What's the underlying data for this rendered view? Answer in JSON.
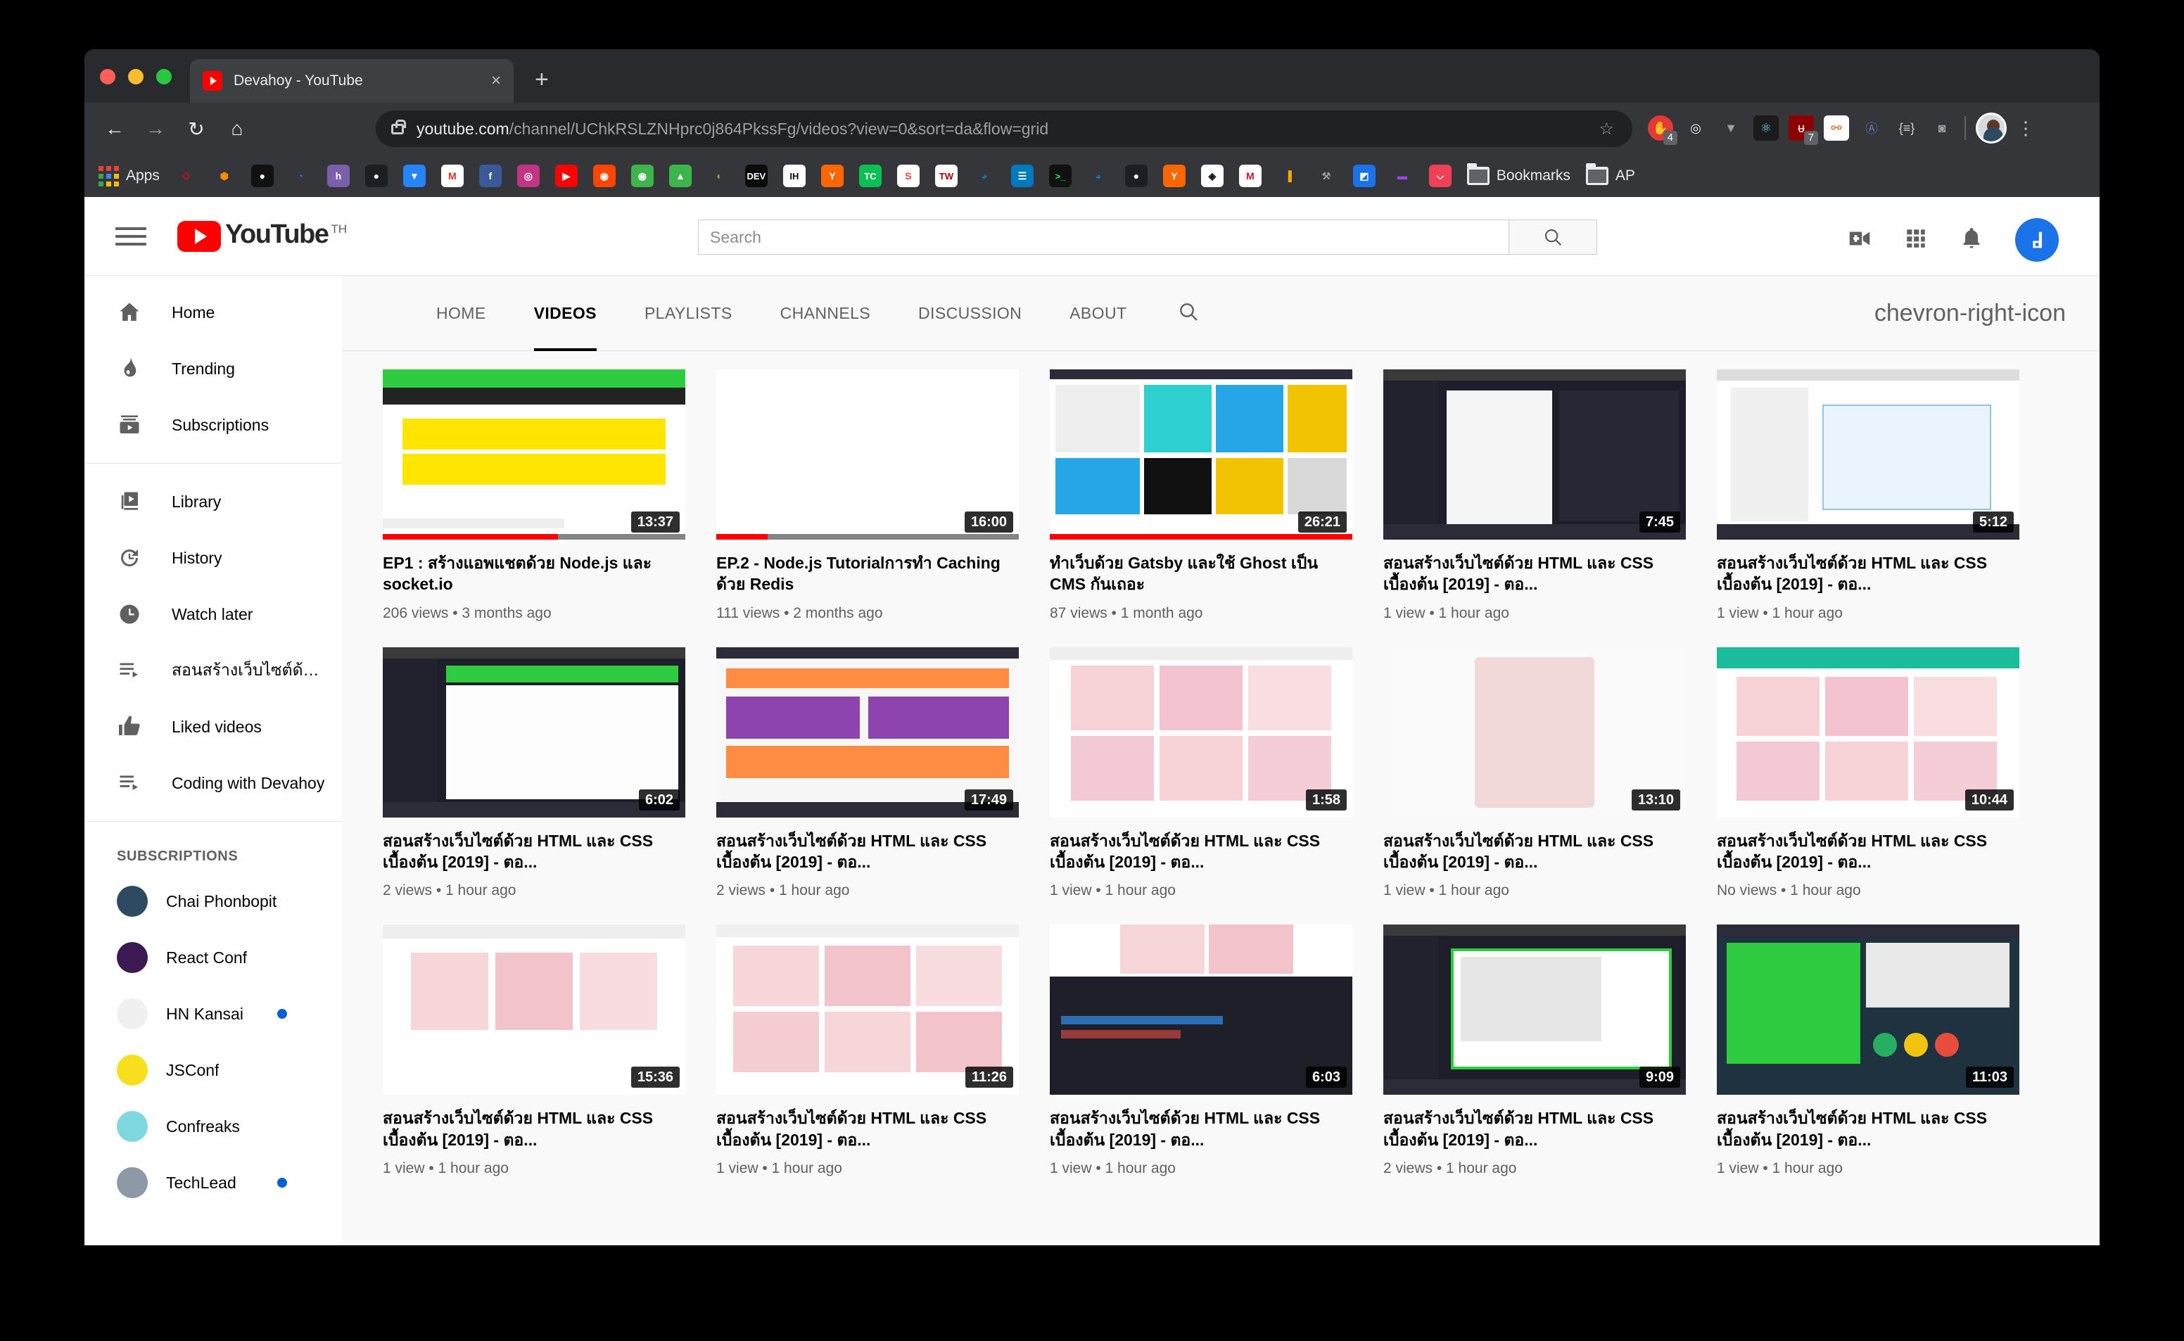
{
  "browser": {
    "tab_title": "Devahoy - YouTube",
    "tab_close": "×",
    "new_tab": "+",
    "nav": {
      "back": "←",
      "forward": "→",
      "reload": "↻",
      "home": "⌂"
    },
    "url_host": "youtube.com",
    "url_path": "/channel/UChkRSLZNHprc0j864PkssFg/videos?view=0&sort=da&flow=grid",
    "star": "☆",
    "kebab": "⋮",
    "extension_badges": {
      "adblock_count": "4",
      "ublock_count": "7"
    },
    "bookmarks": [
      {
        "name": "apps",
        "label": "Apps",
        "icon": "apps-grid-icon",
        "color": "#4285f4"
      },
      {
        "name": "opera",
        "label": "",
        "icon": "opera-icon",
        "glyph": "O",
        "color": "#cc0f16",
        "bg": "transparent"
      },
      {
        "name": "cube",
        "label": "",
        "icon": "orange-cube-icon",
        "glyph": "⬢",
        "color": "#ff8a00",
        "bg": "transparent"
      },
      {
        "name": "panda",
        "label": "",
        "icon": "panda-icon",
        "glyph": "●",
        "color": "#ffffff",
        "bg": "#111111"
      },
      {
        "name": "digitalocean",
        "label": "",
        "icon": "droplet-icon",
        "glyph": "◔",
        "color": "#0080ff",
        "bg": "transparent"
      },
      {
        "name": "heroku",
        "label": "",
        "icon": "heroku-icon",
        "glyph": "h",
        "color": "#ffffff",
        "bg": "#7b5fab"
      },
      {
        "name": "github-1",
        "label": "",
        "icon": "github-icon",
        "glyph": "●",
        "color": "#ffffff",
        "bg": "#1b1f23"
      },
      {
        "name": "bitbucket",
        "label": "",
        "icon": "bitbucket-icon",
        "glyph": "▼",
        "color": "#ffffff",
        "bg": "#2684ff"
      },
      {
        "name": "gmail",
        "label": "",
        "icon": "gmail-icon",
        "glyph": "M",
        "color": "#d93025",
        "bg": "#ffffff"
      },
      {
        "name": "facebook",
        "label": "",
        "icon": "facebook-icon",
        "glyph": "f",
        "color": "#ffffff",
        "bg": "#3b5998"
      },
      {
        "name": "instagram",
        "label": "",
        "icon": "instagram-icon",
        "glyph": "◎",
        "color": "#ffffff",
        "bg": "#c13584"
      },
      {
        "name": "youtube",
        "label": "",
        "icon": "youtube-icon",
        "glyph": "▶",
        "color": "#ffffff",
        "bg": "#ff0000"
      },
      {
        "name": "reddit",
        "label": "",
        "icon": "reddit-icon",
        "glyph": "◉",
        "color": "#ffffff",
        "bg": "#ff4500"
      },
      {
        "name": "ghost",
        "label": "",
        "icon": "ghost-icon",
        "glyph": "◉",
        "color": "#ffffff",
        "bg": "#3eb54b"
      },
      {
        "name": "gitlab",
        "label": "",
        "icon": "fox-icon",
        "glyph": "▲",
        "color": "#ffffff",
        "bg": "#3cb54a"
      },
      {
        "name": "envato",
        "label": "",
        "icon": "leaf-icon",
        "glyph": "◖",
        "color": "#82b541",
        "bg": "transparent"
      },
      {
        "name": "devto",
        "label": "",
        "icon": "devto-icon",
        "glyph": "DEV",
        "color": "#ffffff",
        "bg": "#0a0a0a"
      },
      {
        "name": "indiehackers",
        "label": "",
        "icon": "indiehackers-icon",
        "glyph": "IH",
        "color": "#0a0a0a",
        "bg": "#ffffff"
      },
      {
        "name": "ycombinator",
        "label": "",
        "icon": "ycombinator-icon",
        "glyph": "Y",
        "color": "#ffffff",
        "bg": "#ff6600"
      },
      {
        "name": "techcrunch",
        "label": "",
        "icon": "techcrunch-icon",
        "glyph": "TC",
        "color": "#ffffff",
        "bg": "#0abf53"
      },
      {
        "name": "sitepoint",
        "label": "",
        "icon": "s-icon",
        "glyph": "S",
        "color": "#e8453c",
        "bg": "#ffffff"
      },
      {
        "name": "tw",
        "label": "",
        "icon": "tw-icon",
        "glyph": "TW",
        "color": "#a30000",
        "bg": "#ffffff"
      },
      {
        "name": "droplet-2",
        "label": "",
        "icon": "droplet-icon",
        "glyph": "◕",
        "color": "#0a7bbf",
        "bg": "transparent"
      },
      {
        "name": "trello",
        "label": "",
        "icon": "trello-icon",
        "glyph": "☰",
        "color": "#ffffff",
        "bg": "#0079bf"
      },
      {
        "name": "hashicorp",
        "label": "",
        "icon": "terminal-icon",
        "glyph": ">_",
        "color": "#00ff41",
        "bg": "#111111"
      },
      {
        "name": "droplet-3",
        "label": "",
        "icon": "droplet-icon",
        "glyph": "◕",
        "color": "#0a7bbf",
        "bg": "transparent"
      },
      {
        "name": "github-2",
        "label": "",
        "icon": "github-icon",
        "glyph": "●",
        "color": "#ffffff",
        "bg": "#1b1f23"
      },
      {
        "name": "ycombinator-2",
        "label": "",
        "icon": "ycombinator-icon",
        "glyph": "Y",
        "color": "#ffffff",
        "bg": "#ff6600"
      },
      {
        "name": "gem",
        "label": "",
        "icon": "diamond-icon",
        "glyph": "◈",
        "color": "#111111",
        "bg": "#ffffff"
      },
      {
        "name": "medium-m",
        "label": "",
        "icon": "medium-icon",
        "glyph": "M",
        "color": "#c41230",
        "bg": "#ffffff"
      },
      {
        "name": "analytics",
        "label": "",
        "icon": "bar-chart-icon",
        "glyph": "▐",
        "color": "#f9ab00",
        "bg": "transparent"
      },
      {
        "name": "toolbox",
        "label": "",
        "icon": "toolbox-icon",
        "glyph": "⚒",
        "color": "#9aa0a6",
        "bg": "transparent"
      },
      {
        "name": "blue-app",
        "label": "",
        "icon": "blue-square-icon",
        "glyph": "◩",
        "color": "#ffffff",
        "bg": "#1a73e8"
      },
      {
        "name": "purple-tag",
        "label": "",
        "icon": "tag-icon",
        "glyph": "▬",
        "color": "#a142f4",
        "bg": "transparent"
      },
      {
        "name": "pocket",
        "label": "",
        "icon": "pocket-icon",
        "glyph": "⌵",
        "color": "#ffffff",
        "bg": "#ef4056"
      },
      {
        "name": "bookmarks-folder",
        "label": "Bookmarks",
        "icon": "folder-icon"
      },
      {
        "name": "ap-folder",
        "label": "AP",
        "icon": "folder-icon"
      }
    ]
  },
  "youtube": {
    "logo_word": "YouTube",
    "country_code": "TH",
    "search": {
      "placeholder": "Search",
      "value": "",
      "button_icon": "search-icon"
    },
    "header_actions": [
      {
        "name": "create-video-button",
        "icon": "video-plus-icon"
      },
      {
        "name": "apps-button",
        "icon": "apps-grid-icon"
      },
      {
        "name": "notifications-button",
        "icon": "bell-icon"
      },
      {
        "name": "account-avatar",
        "icon": "avatar-icon",
        "color": "#1a73e8",
        "glyph": "d"
      }
    ],
    "sidebar": {
      "primary": [
        {
          "label": "Home",
          "icon": "home-icon"
        },
        {
          "label": "Trending",
          "icon": "flame-icon"
        },
        {
          "label": "Subscriptions",
          "icon": "subscriptions-icon"
        }
      ],
      "library": [
        {
          "label": "Library",
          "icon": "library-icon"
        },
        {
          "label": "History",
          "icon": "history-icon"
        },
        {
          "label": "Watch later",
          "icon": "clock-icon"
        },
        {
          "label": "สอนสร้างเว็บไซต์ด้วย ...",
          "icon": "playlist-icon"
        },
        {
          "label": "Liked videos",
          "icon": "thumbs-up-icon"
        },
        {
          "label": "Coding with Devahoy",
          "icon": "playlist-icon"
        }
      ],
      "subscriptions_heading": "SUBSCRIPTIONS",
      "subscriptions": [
        {
          "label": "Chai Phonbopit",
          "avatar": "person-avatar",
          "color": "#2e4a63",
          "unread": false
        },
        {
          "label": "React Conf",
          "avatar": "react-conf-avatar",
          "color": "#3b1a52",
          "unread": false
        },
        {
          "label": "HN Kansai",
          "avatar": "hn-kansai-avatar",
          "color": "#f0f0f0",
          "unread": true
        },
        {
          "label": "JSConf",
          "avatar": "jsconf-avatar",
          "color": "#f7df1e",
          "unread": false
        },
        {
          "label": "Confreaks",
          "avatar": "confreaks-avatar",
          "color": "#7fd8e0",
          "unread": false
        },
        {
          "label": "TechLead",
          "avatar": "techlead-avatar",
          "color": "#8d9aa6",
          "unread": true
        }
      ]
    },
    "channel_tabs": [
      {
        "label": "HOME",
        "active": false
      },
      {
        "label": "VIDEOS",
        "active": true
      },
      {
        "label": "PLAYLISTS",
        "active": false
      },
      {
        "label": "CHANNELS",
        "active": false
      },
      {
        "label": "DISCUSSION",
        "active": false
      },
      {
        "label": "ABOUT",
        "active": false
      }
    ],
    "channel_tabs_search_icon": "search-icon",
    "channel_tabs_more_icon": "chevron-right-icon",
    "videos": [
      {
        "title": "EP1 : สร้างแอพแชตด้วย Node.js และ socket.io",
        "duration": "13:37",
        "views": "206 views",
        "age": "3 months ago",
        "progress": 58,
        "scene": "chat-app"
      },
      {
        "title": "EP.2 - Node.js Tutorialการทำ Caching ด้วย Redis",
        "duration": "16:00",
        "views": "111 views",
        "age": "2 months ago",
        "progress": 17,
        "scene": "redis"
      },
      {
        "title": "ทำเว็บด้วย Gatsby และใช้ Ghost เป็น CMS กันเถอะ",
        "duration": "26:21",
        "views": "87 views",
        "age": "1 month ago",
        "progress": 100,
        "scene": "gatsby"
      },
      {
        "title": "สอนสร้างเว็บไซต์ด้วย HTML และ CSS เบื้องต้น [2019] - ตอ...",
        "duration": "7:45",
        "views": "1 view",
        "age": "1 hour ago",
        "progress": 0,
        "scene": "editor-dark"
      },
      {
        "title": "สอนสร้างเว็บไซต์ด้วย HTML และ CSS เบื้องต้น [2019] - ตอ...",
        "duration": "5:12",
        "views": "1 view",
        "age": "1 hour ago",
        "progress": 0,
        "scene": "selector"
      },
      {
        "title": "สอนสร้างเว็บไซต์ด้วย HTML และ CSS เบื้องต้น [2019] - ตอ...",
        "duration": "6:02",
        "views": "2 views",
        "age": "1 hour ago",
        "progress": 0,
        "scene": "editor-green"
      },
      {
        "title": "สอนสร้างเว็บไซต์ด้วย HTML และ CSS เบื้องต้น [2019] - ตอ...",
        "duration": "17:49",
        "views": "2 views",
        "age": "1 hour ago",
        "progress": 0,
        "scene": "flexbox"
      },
      {
        "title": "สอนสร้างเว็บไซต์ด้วย HTML และ CSS เบื้องต้น [2019] - ตอ...",
        "duration": "1:58",
        "views": "1 view",
        "age": "1 hour ago",
        "progress": 0,
        "scene": "gallery-pink"
      },
      {
        "title": "สอนสร้างเว็บไซต์ด้วย HTML และ CSS เบื้องต้น [2019] - ตอ...",
        "duration": "13:10",
        "views": "1 view",
        "age": "1 hour ago",
        "progress": 0,
        "scene": "portrait"
      },
      {
        "title": "สอนสร้างเว็บไซต์ด้วย HTML และ CSS เบื้องต้น [2019] - ตอ...",
        "duration": "10:44",
        "views": "No views",
        "age": "1 hour ago",
        "progress": 0,
        "scene": "gallery-teal"
      },
      {
        "title": "สอนสร้างเว็บไซต์ด้วย HTML และ CSS เบื้องต้น [2019] - ตอ...",
        "duration": "15:36",
        "views": "1 view",
        "age": "1 hour ago",
        "progress": 0,
        "scene": "myportfolio"
      },
      {
        "title": "สอนสร้างเว็บไซต์ด้วย HTML และ CSS เบื้องต้น [2019] - ตอ...",
        "duration": "11:26",
        "views": "1 view",
        "age": "1 hour ago",
        "progress": 0,
        "scene": "gallery-grid"
      },
      {
        "title": "สอนสร้างเว็บไซต์ด้วย HTML และ CSS เบื้องต้น [2019] - ตอ...",
        "duration": "6:03",
        "views": "1 view",
        "age": "1 hour ago",
        "progress": 0,
        "scene": "timeline"
      },
      {
        "title": "สอนสร้างเว็บไซต์ด้วย HTML และ CSS เบื้องต้น [2019] - ตอ...",
        "duration": "9:09",
        "views": "2 views",
        "age": "1 hour ago",
        "progress": 0,
        "scene": "green-box"
      },
      {
        "title": "สอนสร้างเว็บไซต์ด้วย HTML และ CSS เบื้องต้น [2019] - ตอ...",
        "duration": "11:03",
        "views": "1 view",
        "age": "1 hour ago",
        "progress": 0,
        "scene": "flexbox-project"
      }
    ]
  }
}
